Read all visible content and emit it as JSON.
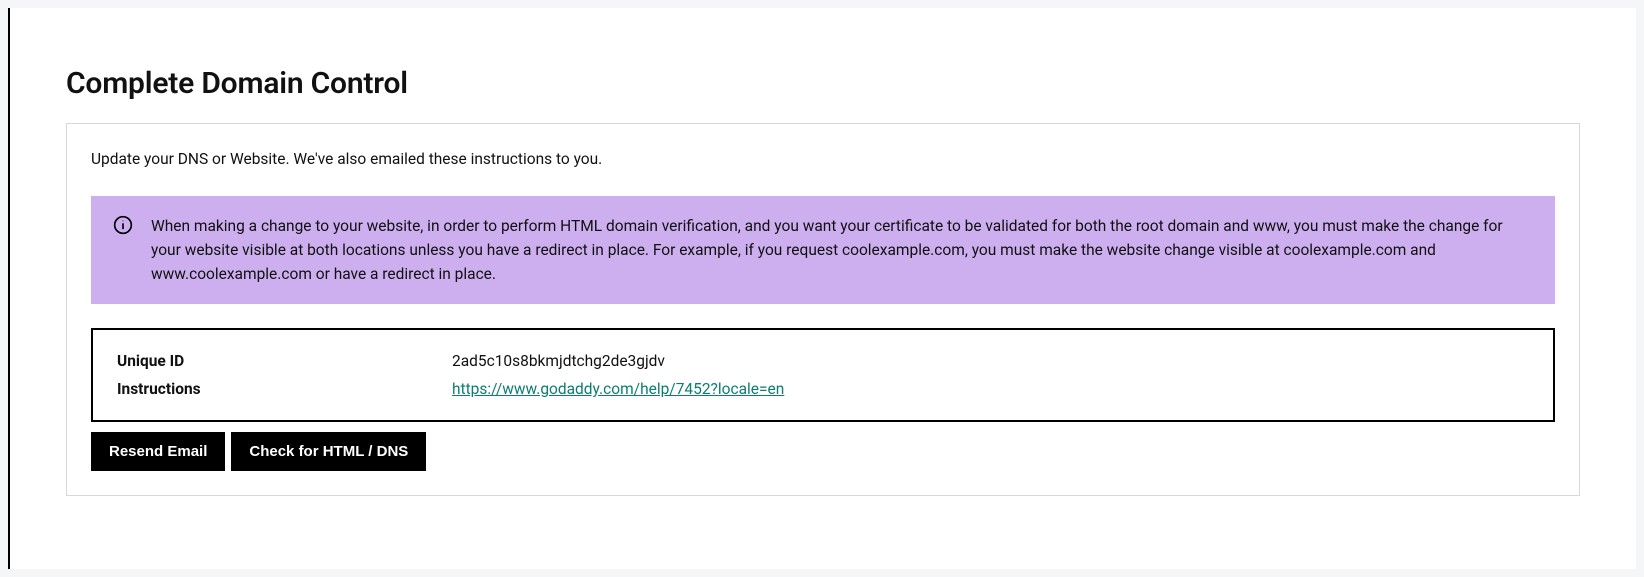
{
  "title": "Complete Domain Control",
  "subtext": "Update your DNS or Website. We've also emailed these instructions to you.",
  "notice": {
    "text": "When making a change to your website, in order to perform HTML domain verification, and you want your certificate to be validated for both the root domain and www, you must make the change for your website visible at both locations unless you have a redirect in place. For example, if you request coolexample.com, you must make the website change visible at coolexample.com and www.coolexample.com or have a redirect in place."
  },
  "details": {
    "unique_id_label": "Unique ID",
    "unique_id_value": "2ad5c10s8bkmjdtchg2de3gjdv",
    "instructions_label": "Instructions",
    "instructions_link_text": "https://www.godaddy.com/help/7452?locale=en",
    "instructions_link_href": "https://www.godaddy.com/help/7452?locale=en"
  },
  "buttons": {
    "resend": "Resend Email",
    "check": "Check for HTML / DNS"
  }
}
